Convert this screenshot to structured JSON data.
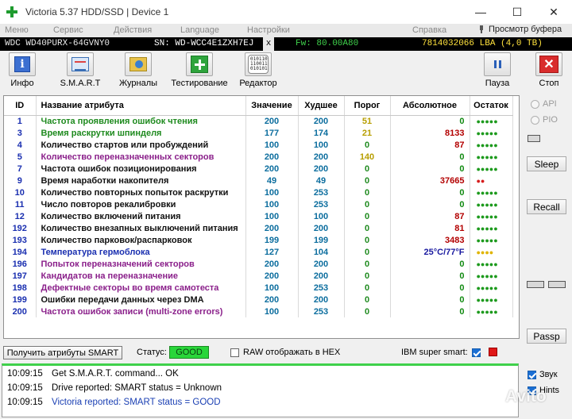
{
  "window": {
    "title": "Victoria 5.37 HDD/SSD | Device 1",
    "controls": {
      "minimize": "—",
      "maximize": "☐",
      "close": "✕"
    }
  },
  "menu": {
    "items": [
      "Меню",
      "Сервис",
      "Действия",
      "Language",
      "Настройки",
      "Справка"
    ],
    "buffer_viewer": "Просмотр буфера"
  },
  "drive": {
    "model": "WDC WD40PURX-64GVNY0",
    "serial": "SN: WD-WCC4E1ZXH7EJ",
    "close": "x",
    "firmware": "Fw: 80.00A80",
    "lba": "7814032066 LBA (4,0 TB)"
  },
  "toolbar": {
    "info": "Инфо",
    "smart": "S.M.A.R.T",
    "logs": "Журналы",
    "testing": "Тестирование",
    "editor": "Редактор",
    "editor_icon": "010110 110011 010101",
    "pause": "Пауза",
    "stop": "Стоп",
    "stop_icon": "✕"
  },
  "table": {
    "headers": {
      "id": "ID",
      "name": "Название атрибута",
      "value": "Значение",
      "worst": "Худшее",
      "threshold": "Порог",
      "raw": "Абсолютное",
      "remaining": "Остаток"
    },
    "rows": [
      {
        "id": "1",
        "name": "Частота проявления ошибок чтения",
        "value": "200",
        "worst": "200",
        "thr": "51",
        "raw": "0",
        "rem": "●●●●●"
      },
      {
        "id": "3",
        "name": "Время раскрутки шпинделя",
        "value": "177",
        "worst": "174",
        "thr": "21",
        "raw": "8133",
        "rem": "●●●●●"
      },
      {
        "id": "4",
        "name": "Количество стартов или пробуждений",
        "value": "100",
        "worst": "100",
        "thr": "0",
        "raw": "87",
        "rem": "●●●●●"
      },
      {
        "id": "5",
        "name": "Количество переназначенных секторов",
        "value": "200",
        "worst": "200",
        "thr": "140",
        "raw": "0",
        "rem": "●●●●●"
      },
      {
        "id": "7",
        "name": "Частота ошибок позиционирования",
        "value": "200",
        "worst": "200",
        "thr": "0",
        "raw": "0",
        "rem": "●●●●●"
      },
      {
        "id": "9",
        "name": "Время наработки накопителя",
        "value": "49",
        "worst": "49",
        "thr": "0",
        "raw": "37665",
        "rem": "●●"
      },
      {
        "id": "10",
        "name": "Количество повторных попыток раскрутки",
        "value": "100",
        "worst": "253",
        "thr": "0",
        "raw": "0",
        "rem": "●●●●●"
      },
      {
        "id": "11",
        "name": "Число повторов рекалибровки",
        "value": "100",
        "worst": "253",
        "thr": "0",
        "raw": "0",
        "rem": "●●●●●"
      },
      {
        "id": "12",
        "name": "Количество включений питания",
        "value": "100",
        "worst": "100",
        "thr": "0",
        "raw": "87",
        "rem": "●●●●●"
      },
      {
        "id": "192",
        "name": "Количество внезапных выключений питания",
        "value": "200",
        "worst": "200",
        "thr": "0",
        "raw": "81",
        "rem": "●●●●●"
      },
      {
        "id": "193",
        "name": "Количество парковок/распарковок",
        "value": "199",
        "worst": "199",
        "thr": "0",
        "raw": "3483",
        "rem": "●●●●●"
      },
      {
        "id": "194",
        "name": "Температура гермоблока",
        "value": "127",
        "worst": "104",
        "thr": "0",
        "raw": "25°C/77°F",
        "rem": "●●●●"
      },
      {
        "id": "196",
        "name": "Попыток переназначений секторов",
        "value": "200",
        "worst": "200",
        "thr": "0",
        "raw": "0",
        "rem": "●●●●●"
      },
      {
        "id": "197",
        "name": "Кандидатов на переназначение",
        "value": "200",
        "worst": "200",
        "thr": "0",
        "raw": "0",
        "rem": "●●●●●"
      },
      {
        "id": "198",
        "name": "Дефектные секторы во время самотеста",
        "value": "100",
        "worst": "253",
        "thr": "0",
        "raw": "0",
        "rem": "●●●●●"
      },
      {
        "id": "199",
        "name": "Ошибки передачи данных через DMA",
        "value": "200",
        "worst": "200",
        "thr": "0",
        "raw": "0",
        "rem": "●●●●●"
      },
      {
        "id": "200",
        "name": "Частота ошибок записи (multi-zone errors)",
        "value": "100",
        "worst": "253",
        "thr": "0",
        "raw": "0",
        "rem": "●●●●●"
      }
    ]
  },
  "colors": {
    "name": [
      "#1e8a1e",
      "#1e8a1e",
      "#111111",
      "#8a1f8a",
      "#111111",
      "#111111",
      "#111111",
      "#111111",
      "#111111",
      "#111111",
      "#111111",
      "#1a2fb0",
      "#8a1f8a",
      "#8a1f8a",
      "#8a1f8a",
      "#111111",
      "#8a1f8a"
    ],
    "raw": [
      "g",
      "r",
      "r",
      "g",
      "g",
      "r",
      "g",
      "g",
      "r",
      "r",
      "r",
      "b",
      "g",
      "g",
      "g",
      "g",
      "g"
    ],
    "thr": [
      "y",
      "y",
      "g",
      "y",
      "g",
      "g",
      "g",
      "g",
      "g",
      "g",
      "g",
      "g",
      "g",
      "g",
      "g",
      "g",
      "g"
    ],
    "rem": [
      "g",
      "g",
      "g",
      "g",
      "g",
      "r",
      "g",
      "g",
      "g",
      "g",
      "g",
      "y",
      "g",
      "g",
      "g",
      "g",
      "g"
    ]
  },
  "sidebar": {
    "api": "API",
    "pio": "PIO",
    "sleep": "Sleep",
    "recall": "Recall",
    "passp": "Passp"
  },
  "status": {
    "get_attrs": "Получить атрибуты SMART",
    "status_label": "Статус:",
    "status_value": "GOOD",
    "raw_hex": "RAW отображать в HEX",
    "ibm": "IBM super smart:"
  },
  "log": [
    {
      "time": "10:09:15",
      "msg": "Get S.M.A.R.T. command... OK",
      "blue": false
    },
    {
      "time": "10:09:15",
      "msg": "Drive reported: SMART status = Unknown",
      "blue": false
    },
    {
      "time": "10:09:15",
      "msg": "Victoria reported: SMART status = GOOD",
      "blue": true
    }
  ],
  "options": {
    "sound": "Звук",
    "hints": "Hints"
  },
  "watermark": "Avito"
}
